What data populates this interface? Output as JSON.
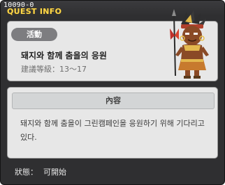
{
  "header": {
    "quest_id": "10090-0",
    "title": "QUEST INFO"
  },
  "summary": {
    "section_label": "活動",
    "quest_name": "돼지와 함께 춤을의 응원",
    "level_label": "建議等級：",
    "level_range": "13～17"
  },
  "content": {
    "header_label": "內容",
    "description": "돼지와 함께 춤을이 그린캠페인을 응원하기 위해 기다리고 있다."
  },
  "status": {
    "label": "狀態：",
    "value": "可開始"
  },
  "colors": {
    "window_bg": "#2f2f31",
    "title": "#ffd84a",
    "panel_bg": "#e7e7e7",
    "pill_bg": "#7d7d80"
  },
  "icons": {
    "npc": "tribal-warrior-npc-icon"
  }
}
